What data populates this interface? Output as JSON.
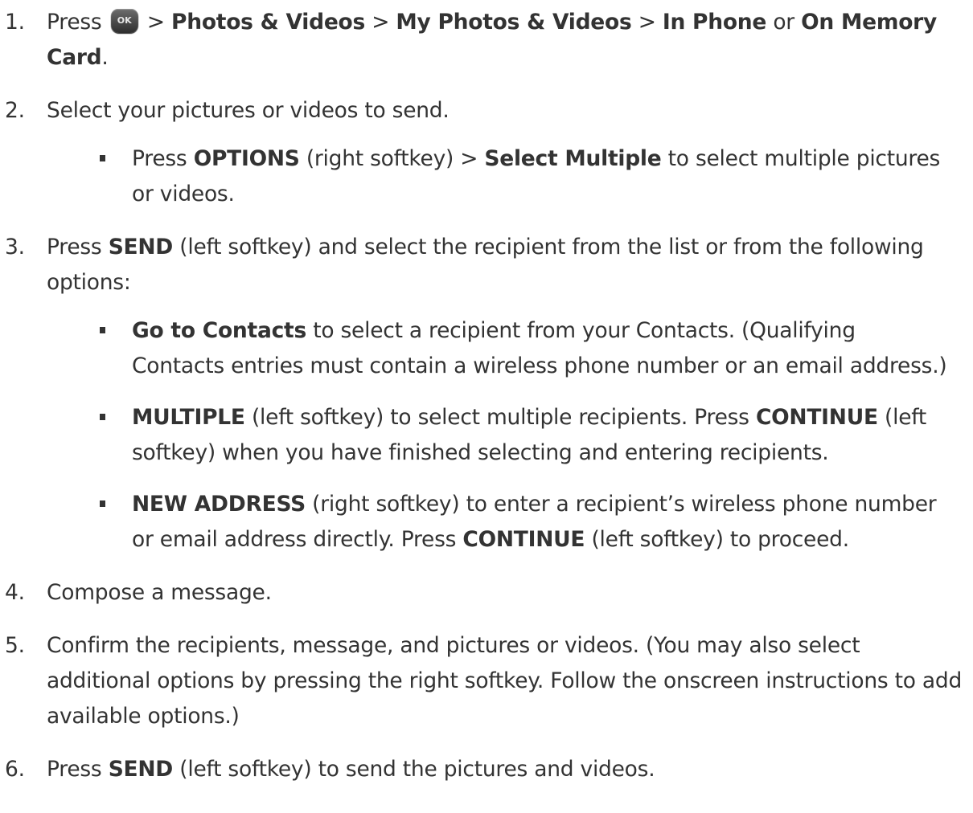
{
  "steps": [
    {
      "num": "1.",
      "pre": "Press",
      "key_label": "OK",
      "sep1": ">",
      "b1": "Photos & Videos",
      "sep2": ">",
      "b2": "My Photos & Videos",
      "sep3": ">",
      "b3": "In Phone",
      "or": "or",
      "b4": "On Memory Card",
      "end": "."
    },
    {
      "num": "2.",
      "text": "Select your pictures or videos to send.",
      "bullets": [
        {
          "t1": "Press",
          "b1": "OPTIONS",
          "t2": "(right softkey) >",
          "b2": "Select Multiple",
          "t3": "to select multiple pictures or videos."
        }
      ]
    },
    {
      "num": "3.",
      "t1": "Press",
      "b1": "SEND",
      "t2": "(left softkey) and select the recipient from the list or from the following options:",
      "bullets": [
        {
          "b1": "Go to Contacts",
          "t1": "to select a recipient from your Contacts. (Qualifying Contacts entries must contain a wireless phone number or an email address.)"
        },
        {
          "b1": "MULTIPLE",
          "t1": "(left softkey) to select multiple recipients. Press",
          "b2": "CONTINUE",
          "t2": "(left softkey) when you have finished selecting and entering recipients."
        },
        {
          "b1": "NEW ADDRESS",
          "t1": "(right softkey) to enter a recipient’s wireless phone number or email address directly. Press",
          "b2": "CONTINUE",
          "t2": "(left softkey) to proceed."
        }
      ]
    },
    {
      "num": "4.",
      "text": "Compose a message."
    },
    {
      "num": "5.",
      "text": "Confirm the recipients, message, and pictures or videos. (You may also select additional options by pressing the right softkey. Follow the onscreen instructions to add available options.)"
    },
    {
      "num": "6.",
      "t1": "Press",
      "b1": "SEND",
      "t2": "(left softkey) to send the pictures and videos."
    }
  ]
}
